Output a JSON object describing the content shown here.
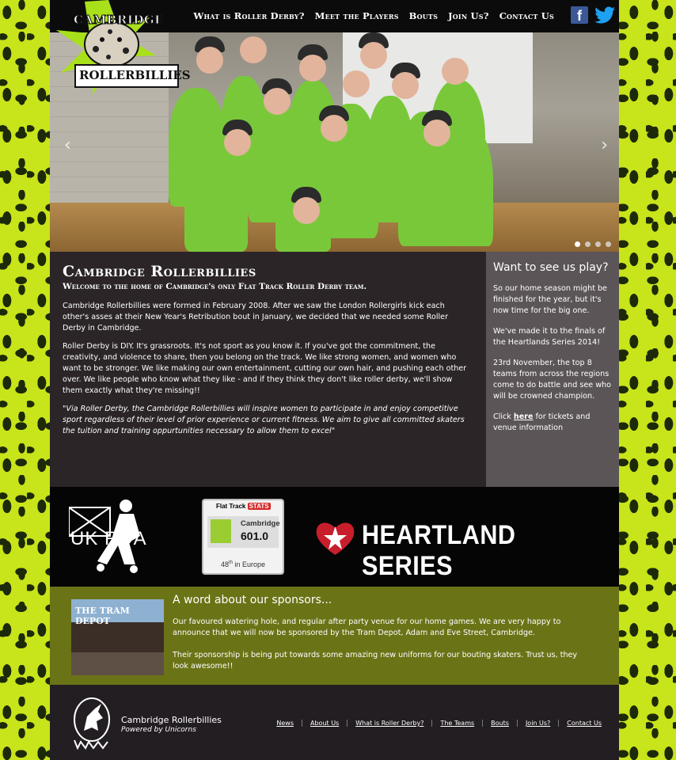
{
  "header": {
    "logo_text_top": "CAMBRIDGE",
    "logo_text_bottom": "ROLLERBILLIES",
    "nav": [
      "What is Roller Derby?",
      "Meet the Players",
      "Bouts",
      "Join Us?",
      "Contact Us"
    ],
    "social": [
      "facebook-icon",
      "twitter-icon"
    ]
  },
  "hero": {
    "prev_arrow": "‹",
    "next_arrow": "›",
    "slides_count": 4,
    "active_slide": 1
  },
  "intro": {
    "title": "Cambridge Rollerbillies",
    "subtitle": "Welcome to the home of Cambridge's only Flat Track Roller Derby team.",
    "p1": "Cambridge Rollerbillies were formed in February 2008. After we saw the London Rollergirls kick each other's asses at their New Year's Retribution bout in January, we decided that we needed some Roller Derby in Cambridge.",
    "p2": "Roller Derby is DIY. It's grassroots. It's not sport as you know it. If you've got the commitment, the creativity, and violence to share, then you  belong on the track. We like strong women, and women who want to be stronger. We like making our own entertainment, cutting our own hair, and pushing each other over. We like people who know what they like - and if they think they don't like roller derby, we'll show them  exactly what they're missing!!",
    "quote": "\"Via Roller Derby, the Cambridge Rollerbillies will inspire women to participate in and enjoy competitive sport regardless of their level of prior experience or current fitness. We aim to give all committed skaters the tuition and training oppurtunities necessary to allow them to excel\""
  },
  "side": {
    "title": "Want to see us play?",
    "p1": "So our home season might be finished for the year, but it's now time for the big one.",
    "p2": "We've made it to the finals of the Heartlands Series 2014!",
    "p3": "23rd November, the top 8 teams from across the regions come to do battle and see who will be crowned champion.",
    "p4_before": "Click ",
    "p4_link": "here",
    "p4_after": " for tickets and venue information"
  },
  "logos": {
    "ukrda": "UK RDA",
    "stats_header": "Flat Track",
    "stats_badge": "STATS",
    "stats_team": "Cambridge",
    "stats_score": "601.0",
    "stats_rank_num": "48",
    "stats_rank_sup": "th",
    "stats_rank_text": " in Europe",
    "heartland": "HEARTLAND SERIES"
  },
  "sponsors": {
    "image_sign": "THE TRAM DEPOT",
    "title": "A word about our sponsors...",
    "p1": "Our favoured watering hole, and regular after party venue for our home games. We are very happy to announce that we will now be sponsored by the Tram Depot, Adam and Eve Street, Cambridge.",
    "p2": "Their sponsorship is being put towards some amazing new uniforms for our bouting skaters. Trust us, they look awesome!!"
  },
  "footer": {
    "title": "Cambridge Rollerbillies",
    "subtitle": "Powered by Unicorns",
    "nav": [
      "News",
      "About Us",
      "What is Roller Derby?",
      "The Teams",
      "Bouts",
      "Join Us?",
      "Contact Us"
    ]
  },
  "colors": {
    "background": "#c8e41a",
    "frame": "#241f22",
    "sidebar": "#5c5558",
    "sponsors": "#6b7317",
    "jersey": "#79c83a"
  }
}
